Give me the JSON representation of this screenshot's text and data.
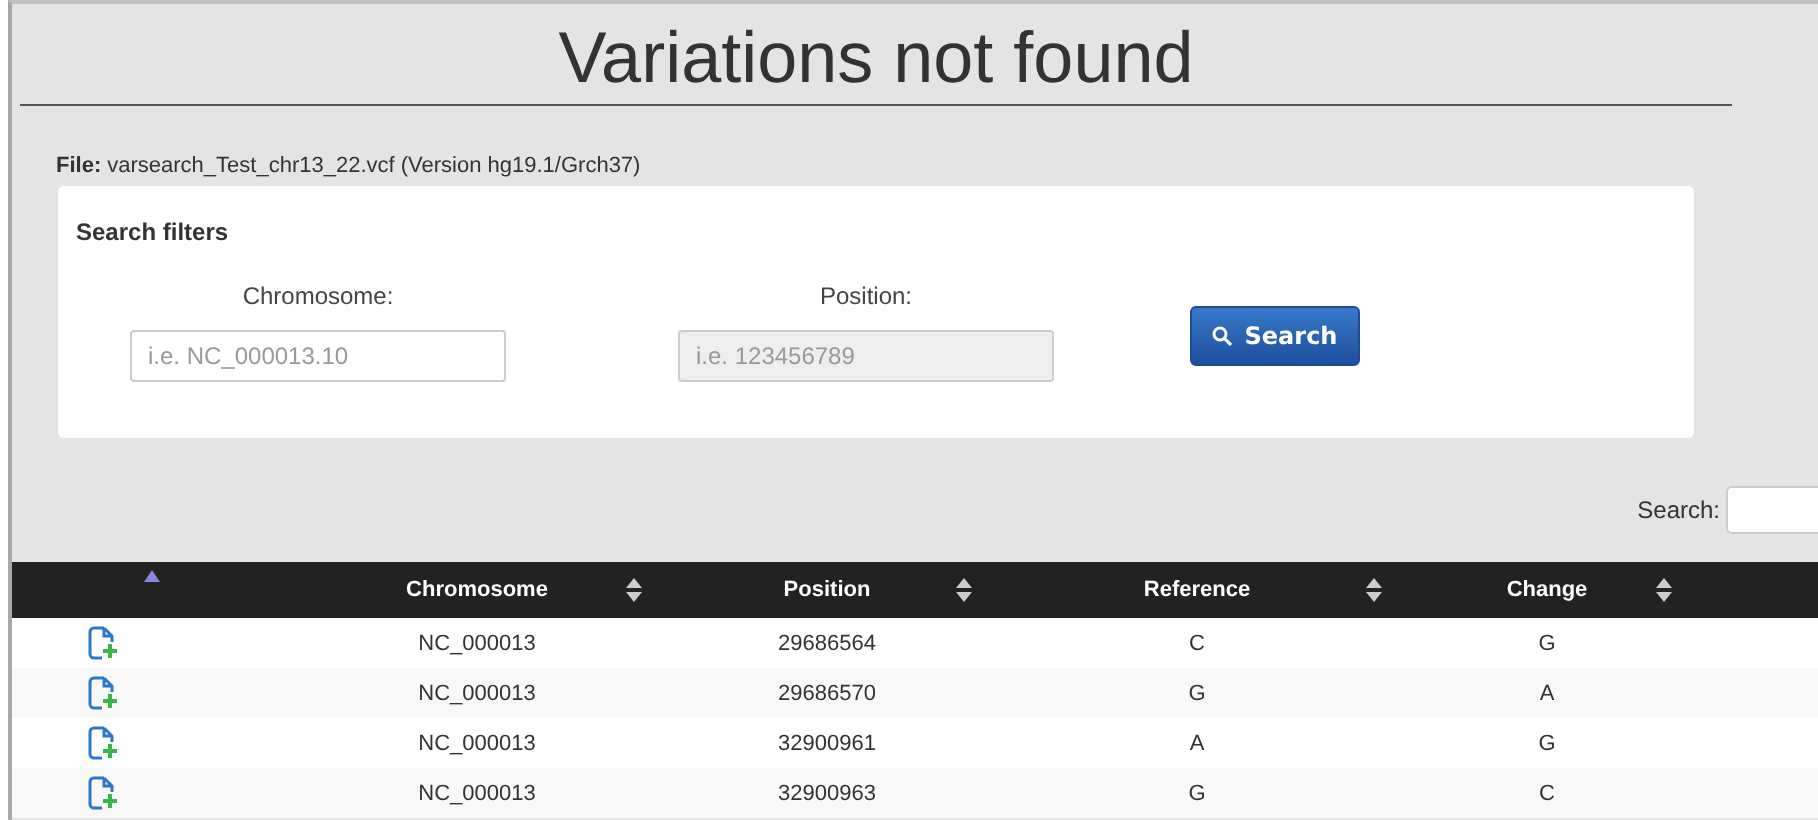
{
  "title": "Variations not found",
  "file": {
    "label": "File:",
    "name": "varsearch_Test_chr13_22.vcf (Version hg19.1/Grch37)"
  },
  "filters": {
    "heading": "Search filters",
    "fields": [
      {
        "label": "Chromosome:",
        "placeholder": "i.e. NC_000013.10",
        "disabled": false
      },
      {
        "label": "Position:",
        "placeholder": "i.e. 123456789",
        "disabled": true
      }
    ],
    "button": "Search"
  },
  "table_search": {
    "label": "Search:"
  },
  "table": {
    "columns": [
      {
        "sorted": true
      },
      {
        "label": "Chromosome",
        "sorted": false
      },
      {
        "label": "Position",
        "sorted": false
      },
      {
        "label": "Reference",
        "sorted": false
      },
      {
        "label": "Change",
        "sorted": false
      }
    ],
    "rows": [
      [
        "",
        "NC_000013",
        "29686564",
        "C",
        "G"
      ],
      [
        "",
        "NC_000013",
        "29686570",
        "G",
        "A"
      ],
      [
        "",
        "NC_000013",
        "32900961",
        "A",
        "G"
      ],
      [
        "",
        "NC_000013",
        "32900963",
        "G",
        "C"
      ]
    ]
  }
}
